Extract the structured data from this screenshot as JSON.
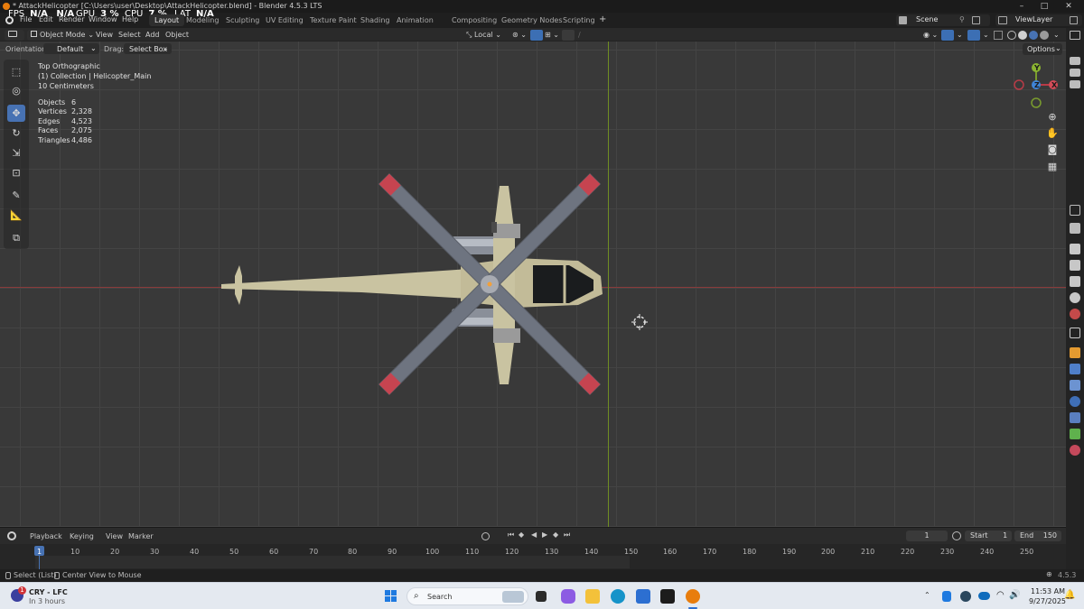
{
  "window": {
    "title": "* AttackHelicopter [C:\\Users\\user\\Desktop\\AttackHelicopter.blend] - Blender 4.5.3 LTS",
    "controls": [
      "–",
      "□",
      "✕"
    ]
  },
  "hud_overlay": {
    "fps_label": "FPS",
    "fps_value": "N/A",
    "fps_extra": "N/A",
    "gpu_label": "GPU",
    "gpu_value": "3 %",
    "cpu_label": "CPU",
    "cpu_value": "7 %",
    "lat_label": "LAT",
    "lat_value": "N/A"
  },
  "menu": {
    "items": [
      "File",
      "Edit",
      "Render",
      "Window",
      "Help"
    ]
  },
  "workspaces": {
    "tabs": [
      "Layout",
      "Modeling",
      "Sculpting",
      "UV Editing",
      "Texture Paint",
      "Shading",
      "Animation",
      "Compositing",
      "Geometry Nodes",
      "Scripting"
    ],
    "active": "Layout",
    "add": "+"
  },
  "scene": {
    "name": "Scene",
    "view_layer": "ViewLayer"
  },
  "viewport_header": {
    "mode": "Object Mode",
    "menus": [
      "View",
      "Select",
      "Add",
      "Object"
    ],
    "pivot": "Local"
  },
  "tool_settings": {
    "orientation_label": "Orientation:",
    "orientation_value": "Default",
    "drag_label": "Drag:",
    "drag_value": "Select Box",
    "options": "Options"
  },
  "viewport_info": {
    "view": "Top Orthographic",
    "collection": "(1) Collection | Helicopter_Main",
    "scale": "10 Centimeters",
    "stats": [
      {
        "label": "Objects",
        "value": "6"
      },
      {
        "label": "Vertices",
        "value": "2,328"
      },
      {
        "label": "Edges",
        "value": "4,523"
      },
      {
        "label": "Faces",
        "value": "2,075"
      },
      {
        "label": "Triangles",
        "value": "4,486"
      }
    ]
  },
  "gizmo": {
    "y": "Y",
    "z": "Z",
    "x": "X"
  },
  "timeline": {
    "menus": [
      "Playback",
      "Keying",
      "View",
      "Marker"
    ],
    "current_frame": "1",
    "start_label": "Start",
    "start_value": "1",
    "end_label": "End",
    "end_value": "150",
    "frame_marks": [
      "1",
      "10",
      "20",
      "30",
      "40",
      "50",
      "60",
      "70",
      "80",
      "90",
      "100",
      "110",
      "120",
      "130",
      "140",
      "150",
      "160",
      "170",
      "180",
      "190",
      "200",
      "210",
      "220",
      "230",
      "240",
      "250"
    ]
  },
  "statusbar": {
    "hint1": "Select (List)",
    "hint2": "Center View to Mouse",
    "version": "4.5.3"
  },
  "taskbar": {
    "weather_title": "CRY - LFC",
    "weather_sub": "In 3 hours",
    "badge": "1",
    "search_placeholder": "Search",
    "time": "11:53 AM",
    "date": "9/27/2025"
  }
}
